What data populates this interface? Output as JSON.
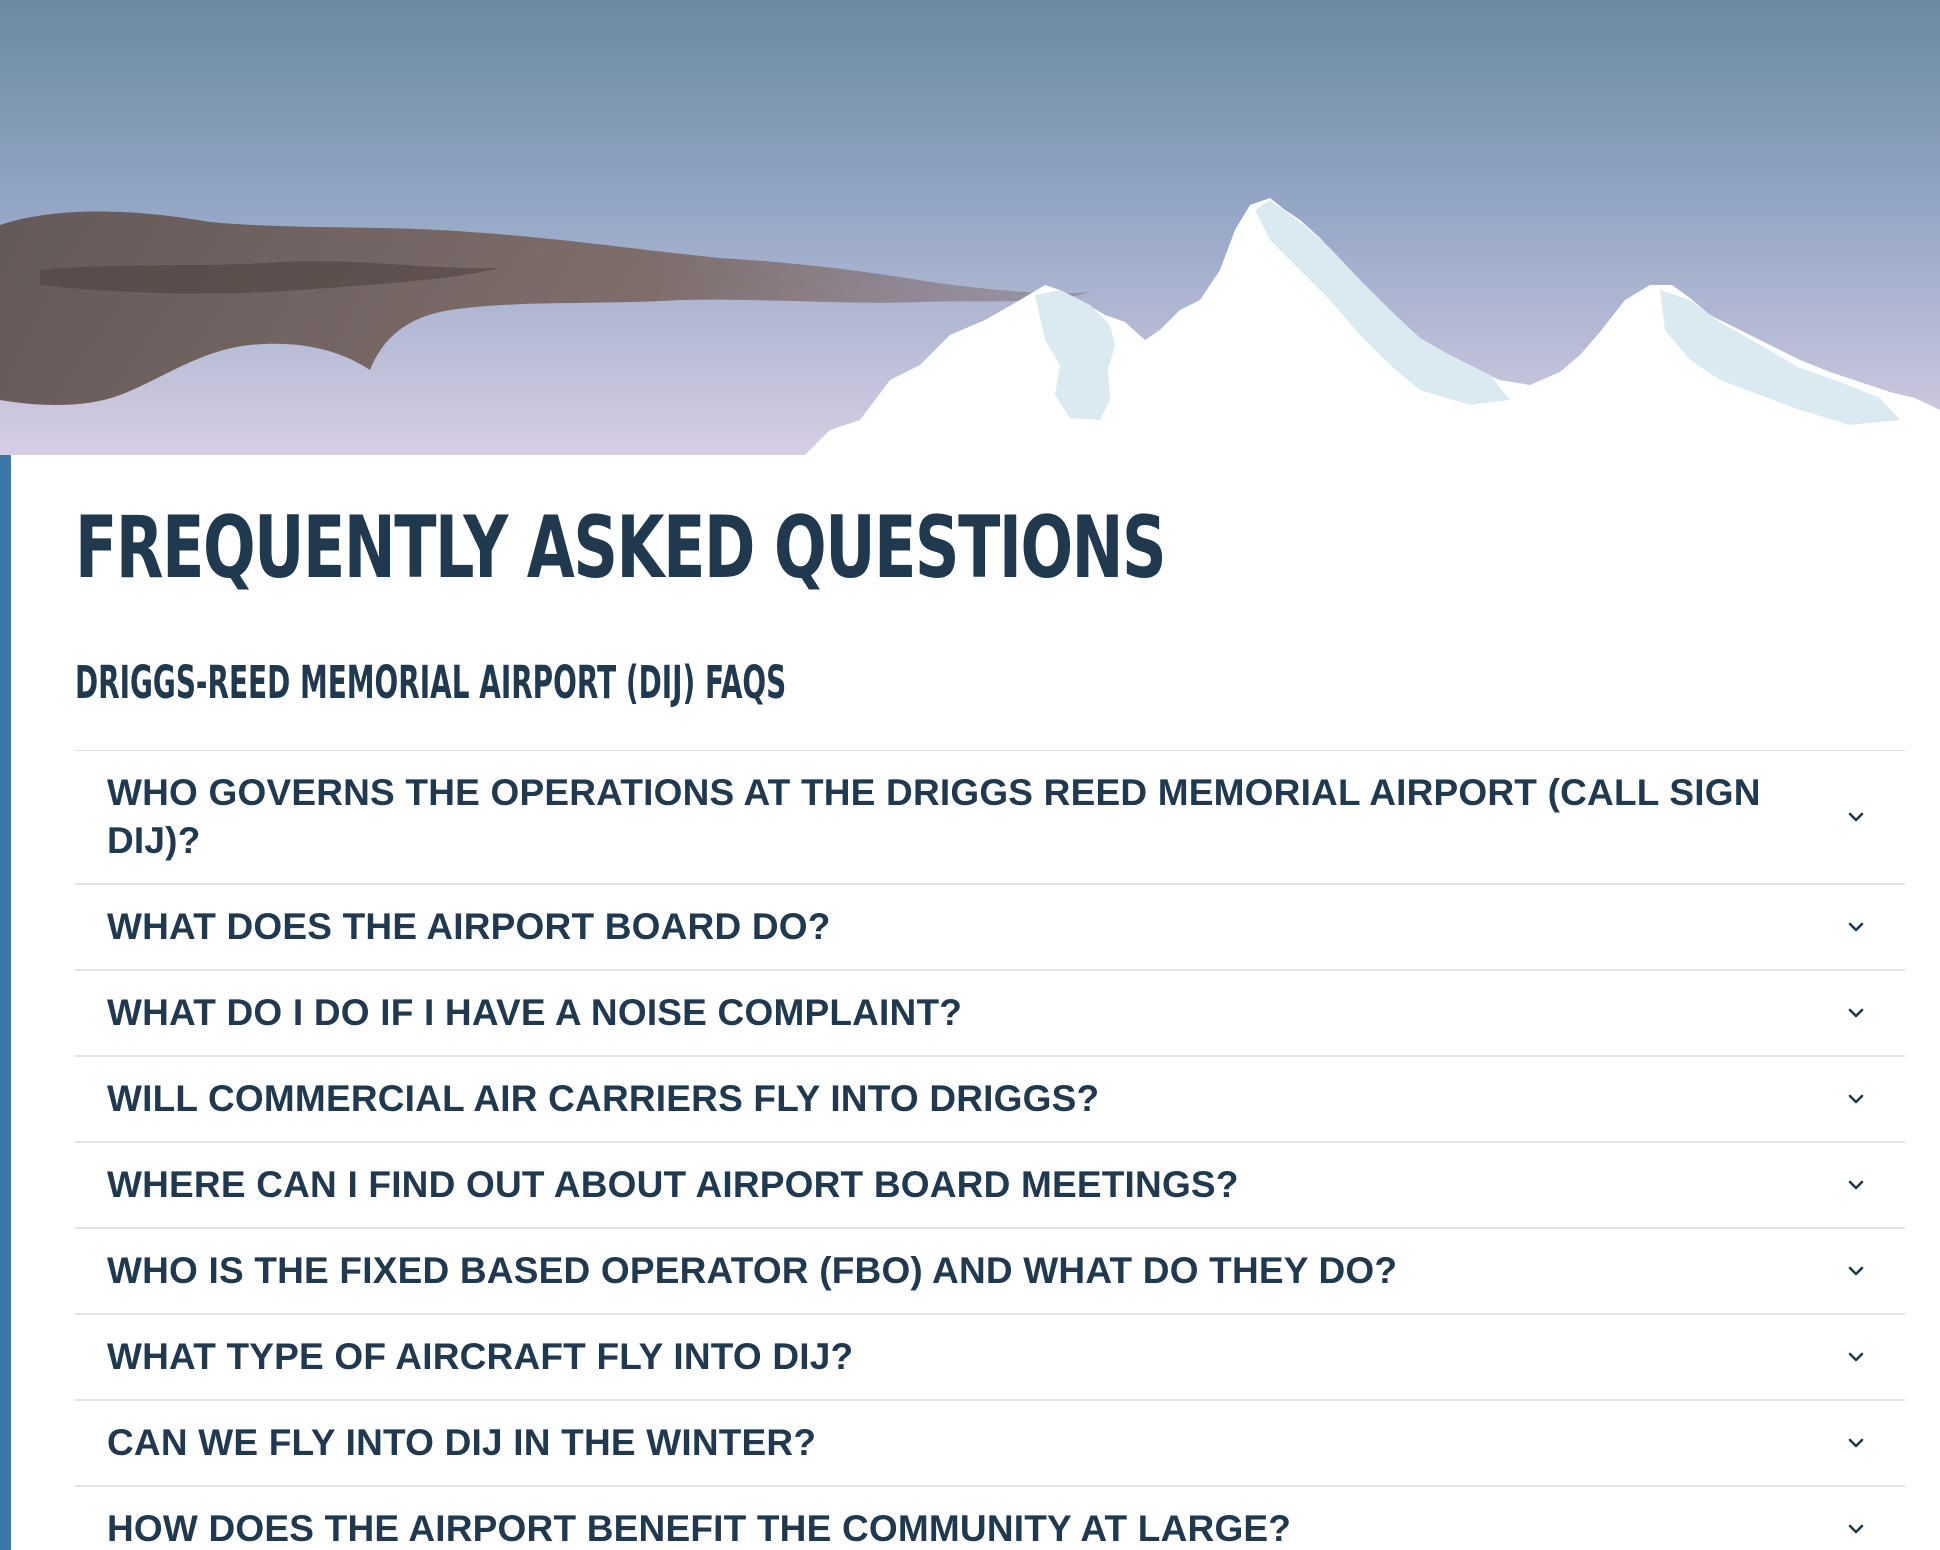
{
  "page": {
    "title": "FREQUENTLY ASKED QUESTIONS",
    "section_title": "DRIGGS-REED MEMORIAL AIRPORT (DIJ) FAQS"
  },
  "hero": {
    "image": "mountain-skyline-illustration",
    "colors": {
      "sky_top": "#6a8aa2",
      "sky_mid": "#94a6c6",
      "sky_bottom": "#d8cfe4",
      "cloud": "#6b5a55",
      "snow": "#ffffff",
      "snow_shadow": "#dbe9f0"
    }
  },
  "colors": {
    "accent_bar": "#3d77a7",
    "heading": "#20394f",
    "divider": "#e4e4e4"
  },
  "faqs": [
    {
      "question": "WHO GOVERNS THE OPERATIONS AT THE DRIGGS REED MEMORIAL AIRPORT (CALL SIGN DIJ)?",
      "icon": "chevron-down-icon"
    },
    {
      "question": "WHAT DOES THE AIRPORT BOARD DO?",
      "icon": "chevron-down-icon"
    },
    {
      "question": "WHAT DO I DO IF I HAVE A NOISE COMPLAINT?",
      "icon": "chevron-down-icon"
    },
    {
      "question": "WILL COMMERCIAL AIR CARRIERS FLY INTO DRIGGS?",
      "icon": "chevron-down-icon"
    },
    {
      "question": "WHERE CAN I FIND OUT ABOUT AIRPORT BOARD MEETINGS?",
      "icon": "chevron-down-icon"
    },
    {
      "question": "WHO IS THE FIXED BASED OPERATOR (FBO) AND WHAT DO THEY DO?",
      "icon": "chevron-down-icon"
    },
    {
      "question": "WHAT TYPE OF AIRCRAFT FLY INTO DIJ?",
      "icon": "chevron-down-icon"
    },
    {
      "question": "CAN WE FLY INTO DIJ IN THE WINTER?",
      "icon": "chevron-down-icon"
    },
    {
      "question": "HOW DOES THE AIRPORT BENEFIT THE COMMUNITY AT LARGE?",
      "icon": "chevron-down-icon"
    }
  ]
}
